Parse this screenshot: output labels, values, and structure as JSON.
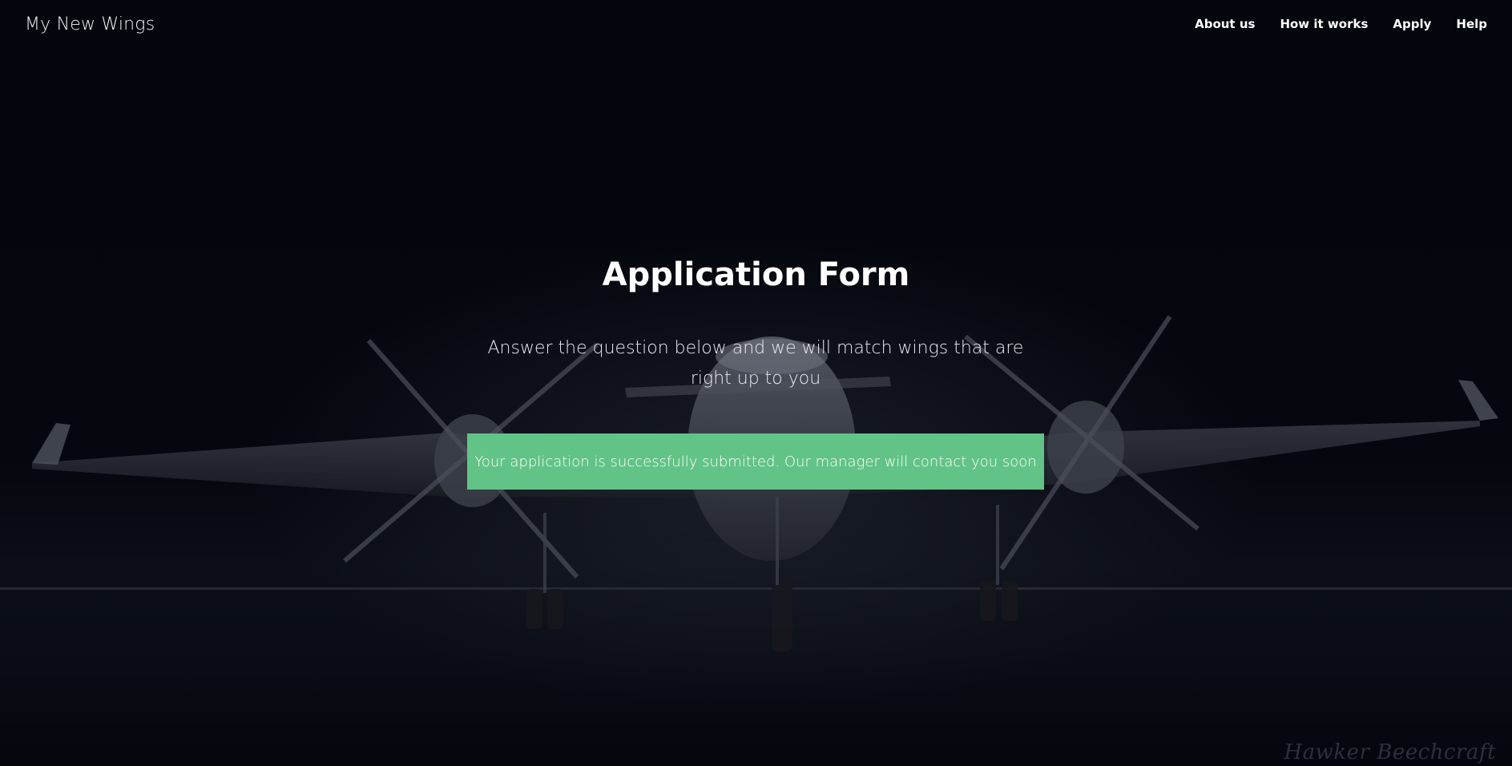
{
  "brand": {
    "name": "My New Wings"
  },
  "nav": {
    "links": [
      "About us",
      "How it works",
      "Apply",
      "Help"
    ]
  },
  "main": {
    "title": "Application Form",
    "subtitle": "Answer the question below and we will match wings that are right up to you",
    "alert": "Your application is successfully submitted. Our manager will contact you soon"
  },
  "background": {
    "watermark": "Hawker Beechcraft"
  },
  "colors": {
    "background": "#04060d",
    "success": "#62c386",
    "text": "#ffffff"
  }
}
